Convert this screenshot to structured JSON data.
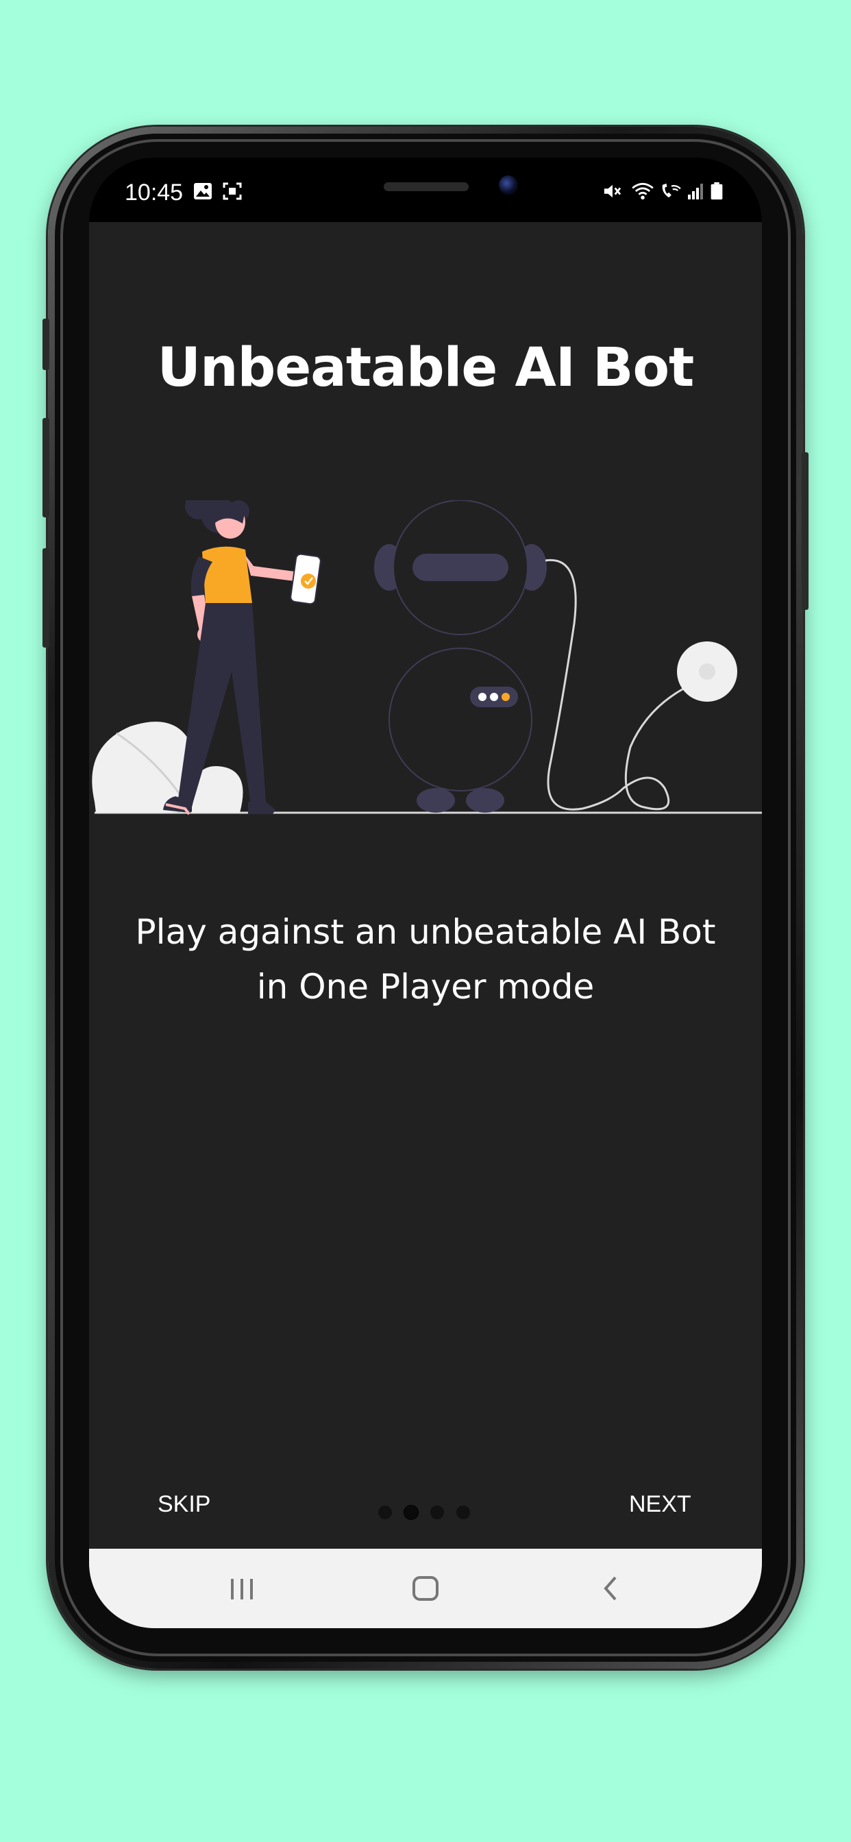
{
  "status_bar": {
    "time": "10:45",
    "left_icons": [
      "image-icon",
      "screenshot-icon"
    ],
    "right_icons": [
      "mute-icon",
      "wifi-icon",
      "wifi-call-icon",
      "signal-icon",
      "battery-icon"
    ]
  },
  "onboarding": {
    "title": "Unbeatable AI Bot",
    "description_line1": "Play against an unbeatable AI Bot",
    "description_line2": "in One Player mode",
    "illustration": "woman-with-phone-and-robot-illustration",
    "page_count": 4,
    "current_page": 2
  },
  "bottom_nav": {
    "skip_label": "SKIP",
    "next_label": "NEXT"
  },
  "system_nav": {
    "buttons": [
      "recent-apps-icon",
      "home-icon",
      "back-icon"
    ]
  },
  "colors": {
    "background": "#a4ffdc",
    "screen": "#212121",
    "accent": "#f9a826",
    "text": "#ffffff"
  }
}
